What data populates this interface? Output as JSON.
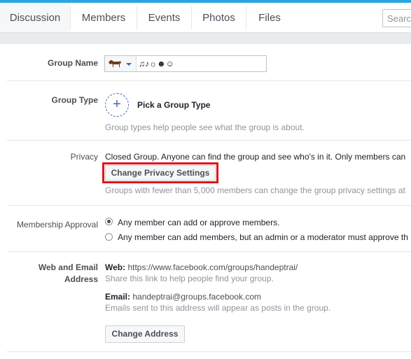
{
  "tabs": [
    {
      "label": "Discussion"
    },
    {
      "label": "Members"
    },
    {
      "label": "Events"
    },
    {
      "label": "Photos"
    },
    {
      "label": "Files"
    }
  ],
  "search": {
    "placeholder": "Search"
  },
  "settings": {
    "group_name": {
      "label": "Group Name",
      "value": "♫♪☼☻☺"
    },
    "group_type": {
      "label": "Group Type",
      "pick_label": "Pick a Group Type",
      "help": "Group types help people see what the group is about."
    },
    "privacy": {
      "label": "Privacy",
      "description": "Closed Group. Anyone can find the group and see who's in it. Only members can",
      "button": "Change Privacy Settings",
      "note": "Groups with fewer than 5,000 members can change the group privacy settings at"
    },
    "membership": {
      "label": "Membership Approval",
      "options": [
        {
          "label": "Any member can add or approve members."
        },
        {
          "label": "Any member can add members, but an admin or a moderator must approve th"
        }
      ]
    },
    "web_email": {
      "label_line1": "Web and Email",
      "label_line2": "Address",
      "web_label": "Web:",
      "web_url": "https://www.facebook.com/groups/handeptrai/",
      "web_help": "Share this link to help people find your group.",
      "email_label": "Email:",
      "email_value": "handeptrai@groups.facebook.com",
      "email_help": "Emails sent to this address will appear as posts in the group.",
      "button": "Change Address"
    }
  },
  "colors": {
    "accent": "#4267b2",
    "highlight": "#e0141e",
    "top_bar": "#29a6e0"
  }
}
